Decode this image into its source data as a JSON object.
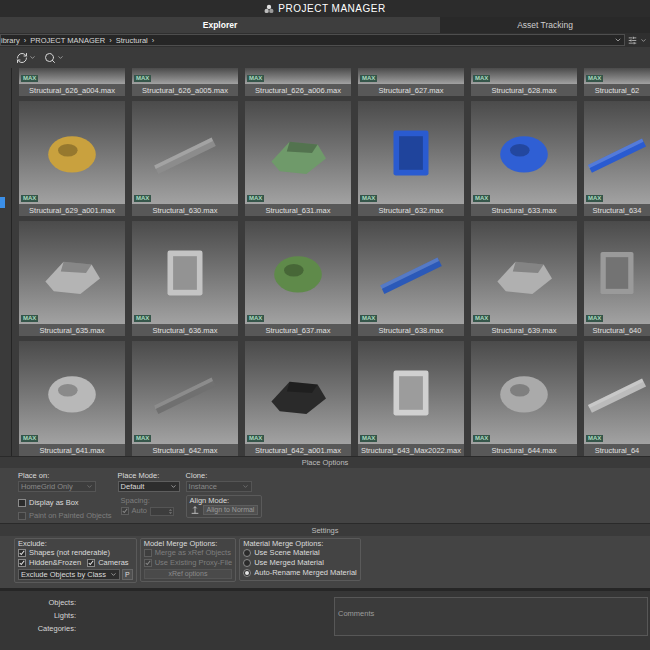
{
  "window": {
    "title": "PROJECT MANAGER"
  },
  "tabs": [
    {
      "label": "Explorer",
      "selected": true
    },
    {
      "label": "Asset Tracking",
      "selected": false
    }
  ],
  "breadcrumb": {
    "items": [
      "ibrary",
      "PROJECT MANAGER",
      "Structural"
    ],
    "separator": "›"
  },
  "sidebar": {
    "has_selection": true
  },
  "assets": [
    {
      "name": "Structural_626_a004.max",
      "badge": "MAX",
      "kind": "cut"
    },
    {
      "name": "Structural_626_a005.max",
      "badge": "MAX",
      "kind": "cut"
    },
    {
      "name": "Structural_626_a006.max",
      "badge": "MAX",
      "kind": "cut"
    },
    {
      "name": "Structural_627.max",
      "badge": "MAX",
      "kind": "cut"
    },
    {
      "name": "Structural_628.max",
      "badge": "MAX",
      "kind": "cut"
    },
    {
      "name": "Structural_62",
      "badge": "MAX",
      "kind": "cut"
    },
    {
      "name": "Structural_629_a001.max",
      "badge": "MAX",
      "kind": "full",
      "color": "#c9a13e"
    },
    {
      "name": "Structural_630.max",
      "badge": "MAX",
      "kind": "full",
      "color": "#8c8c8c"
    },
    {
      "name": "Structural_631.max",
      "badge": "MAX",
      "kind": "full",
      "color": "#6f9a6a"
    },
    {
      "name": "Structural_632.max",
      "badge": "MAX",
      "kind": "full",
      "color": "#2a5bd0"
    },
    {
      "name": "Structural_633.max",
      "badge": "MAX",
      "kind": "full",
      "color": "#2f5fd4"
    },
    {
      "name": "Structural_634",
      "badge": "MAX",
      "kind": "full",
      "color": "#2a5bd0"
    },
    {
      "name": "Structural_635.max",
      "badge": "MAX",
      "kind": "full",
      "color": "#b4b4b4"
    },
    {
      "name": "Structural_636.max",
      "badge": "MAX",
      "kind": "full",
      "color": "#c4c4c4"
    },
    {
      "name": "Structural_637.max",
      "badge": "MAX",
      "kind": "full",
      "color": "#5f8a4a"
    },
    {
      "name": "Structural_638.max",
      "badge": "MAX",
      "kind": "full",
      "color": "#2b59b8"
    },
    {
      "name": "Structural_639.max",
      "badge": "MAX",
      "kind": "full",
      "color": "#b0b0b0"
    },
    {
      "name": "Structural_640",
      "badge": "MAX",
      "kind": "full",
      "color": "#9a9a9a"
    },
    {
      "name": "Structural_641.max",
      "badge": "MAX",
      "kind": "full",
      "color": "#b8b8b8"
    },
    {
      "name": "Structural_642.max",
      "badge": "MAX",
      "kind": "full",
      "color": "#707070"
    },
    {
      "name": "Structural_642_a001.max",
      "badge": "MAX",
      "kind": "full",
      "color": "#2a2a2a"
    },
    {
      "name": "Structural_643_Max2022.max",
      "badge": "MAX",
      "kind": "full",
      "color": "#d0d0d0"
    },
    {
      "name": "Structural_644.max",
      "badge": "MAX",
      "kind": "full",
      "color": "#aaaaaa"
    },
    {
      "name": "Structural_64",
      "badge": "MAX",
      "kind": "full",
      "color": "#bbbbbb"
    }
  ],
  "place_options": {
    "title": "Place Options",
    "place_on": {
      "label": "Place on:",
      "value": "HomeGrid Only",
      "disabled": true
    },
    "display_as_box": {
      "label": "Display as Box",
      "checked": false,
      "disabled": false
    },
    "paint_on_painted": {
      "label": "Paint on Painted Objects",
      "checked": false,
      "disabled": true
    },
    "place_mode": {
      "label": "Place Mode:",
      "value": "Default",
      "disabled": false
    },
    "spacing": {
      "label": "Spacing:",
      "checkbox": {
        "label": "Auto",
        "checked": true,
        "disabled": true
      }
    },
    "clone": {
      "label": "Clone:",
      "value": "Instance",
      "disabled": true
    },
    "align_mode": {
      "label": "Align Mode:",
      "button": "Align to Normal"
    }
  },
  "settings": {
    "title": "Settings",
    "exclude": {
      "label": "Exclude:",
      "checkboxes": [
        {
          "label": "Shapes (not renderable)",
          "checked": true,
          "disabled": false
        },
        {
          "label": "Hidden&Frozen",
          "checked": true,
          "disabled": false
        },
        {
          "label": "Cameras",
          "checked": true,
          "disabled": false
        }
      ],
      "dropdown": "Exclude Objects by Class",
      "button": "P"
    },
    "model_merge": {
      "label": "Model Merge Options:",
      "checkboxes": [
        {
          "label": "Merge as xRef Objects",
          "checked": false,
          "disabled": true
        },
        {
          "label": "Use Existing Proxy-File",
          "checked": true,
          "disabled": true
        }
      ],
      "button": {
        "label": "xRef options",
        "disabled": true
      }
    },
    "material_merge": {
      "label": "Material Merge Options:",
      "options": [
        {
          "label": "Use Scene Material",
          "selected": false
        },
        {
          "label": "Use Merged Material",
          "selected": false
        },
        {
          "label": "Auto-Rename Merged Material",
          "selected": true
        }
      ]
    }
  },
  "info": {
    "fields": [
      "Objects:",
      "Lights:",
      "Categories:"
    ],
    "comments_label": "Comments"
  }
}
